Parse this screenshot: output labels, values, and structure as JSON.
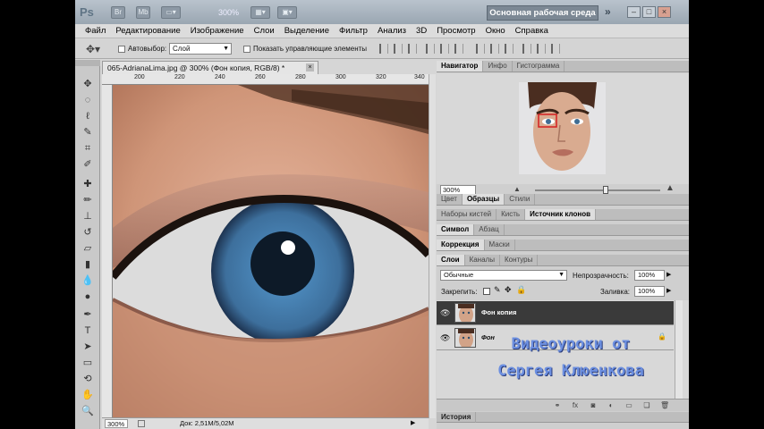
{
  "titlebar": {
    "logo": "Ps",
    "zoom": "300%",
    "workspace": "Основная рабочая среда",
    "btn_br": "Br",
    "btn_mb": "Mb"
  },
  "menu": [
    "Файл",
    "Редактирование",
    "Изображение",
    "Слои",
    "Выделение",
    "Фильтр",
    "Анализ",
    "3D",
    "Просмотр",
    "Окно",
    "Справка"
  ],
  "options": {
    "autoselect_label": "Автовыбор:",
    "autoselect_value": "Слой",
    "show_controls_label": "Показать управляющие элементы"
  },
  "document": {
    "tab_title": "065-AdrianaLima.jpg @ 300% (Фон копия, RGB/8) *",
    "ruler_ticks": [
      "200",
      "220",
      "240",
      "260",
      "280",
      "300",
      "320",
      "340"
    ],
    "status_zoom": "300%",
    "status_doc": "Док: 2,51M/5,02M"
  },
  "navigator": {
    "tabs": [
      "Навигатор",
      "Инфо",
      "Гистограмма"
    ],
    "zoom": "300%"
  },
  "panel_groups": {
    "color_tabs": [
      "Цвет",
      "Образцы",
      "Стили"
    ],
    "brush_tabs": [
      "Наборы кистей",
      "Кисть",
      "Источник клонов"
    ],
    "char_tabs": [
      "Символ",
      "Абзац"
    ],
    "adj_tabs": [
      "Коррекция",
      "Маски"
    ],
    "layer_tabs": [
      "Слои",
      "Каналы",
      "Контуры"
    ]
  },
  "layers": {
    "blend_mode": "Обычные",
    "opacity_label": "Непрозрачность:",
    "opacity_value": "100%",
    "lock_label": "Закрепить:",
    "fill_label": "Заливка:",
    "fill_value": "100%",
    "items": [
      {
        "name": "Фон копия",
        "selected": true
      },
      {
        "name": "Фон",
        "selected": false
      }
    ]
  },
  "history_tab": "История",
  "watermark": {
    "line1": "Видеоуроки от",
    "line2": "Сергея Клюенкова"
  },
  "colors": {
    "titlebar": "#a9b4bf",
    "selected_layer": "#3a3a3a",
    "watermark": "#6c8fe0",
    "iris": "#4a86b8"
  }
}
